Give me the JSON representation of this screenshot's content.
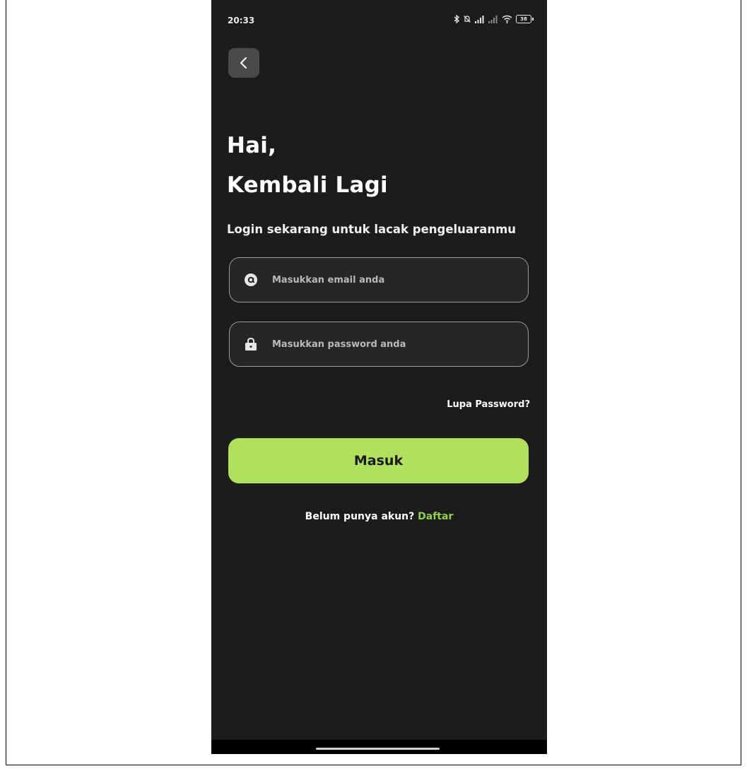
{
  "status_bar": {
    "time": "20:33",
    "battery": "38"
  },
  "login": {
    "greeting_line1": "Hai,",
    "greeting_line2": "Kembali Lagi",
    "subtitle": "Login sekarang untuk lacak pengeluaranmu",
    "email_placeholder": "Masukkan email anda",
    "password_placeholder": "Masukkan password anda",
    "forgot_password": "Lupa Password?",
    "submit_label": "Masuk",
    "no_account_text": "Belum punya akun?",
    "register_link": "Daftar"
  },
  "icons": {
    "back": "chevron-left-icon",
    "email": "at-sign-icon",
    "password": "lock-icon",
    "bluetooth": "bluetooth-icon",
    "mute": "bell-off-icon",
    "signal": "signal-icon",
    "wifi": "wifi-icon",
    "battery": "battery-icon"
  },
  "colors": {
    "background": "#1c1c1c",
    "accent": "#afe05e",
    "link": "#8fd14f"
  }
}
